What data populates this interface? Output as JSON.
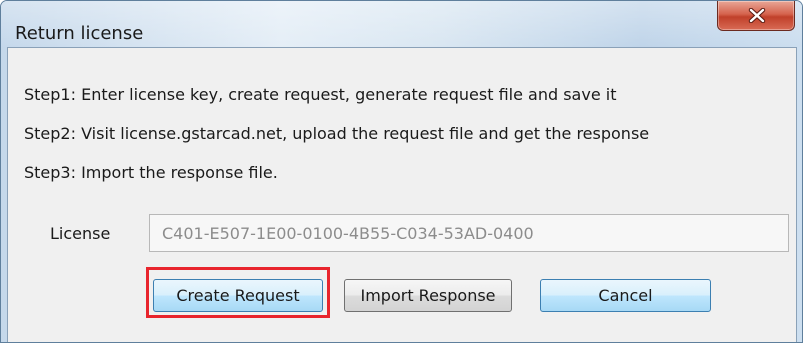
{
  "window": {
    "title": "Return license",
    "close_icon": "close-icon"
  },
  "steps": [
    "Step1: Enter license key, create request, generate request file and save it",
    "Step2: Visit license.gstarcad.net, upload the request file and get the response",
    "Step3: Import the response file."
  ],
  "license": {
    "label": "License",
    "value": "C401-E507-1E00-0100-4B55-C034-53AD-0400"
  },
  "buttons": {
    "create_request": "Create Request",
    "import_response": "Import Response",
    "cancel": "Cancel"
  },
  "colors": {
    "highlight": "#e8252d",
    "close_button": "#c0402a",
    "default_button_border": "#3c7fb1"
  }
}
